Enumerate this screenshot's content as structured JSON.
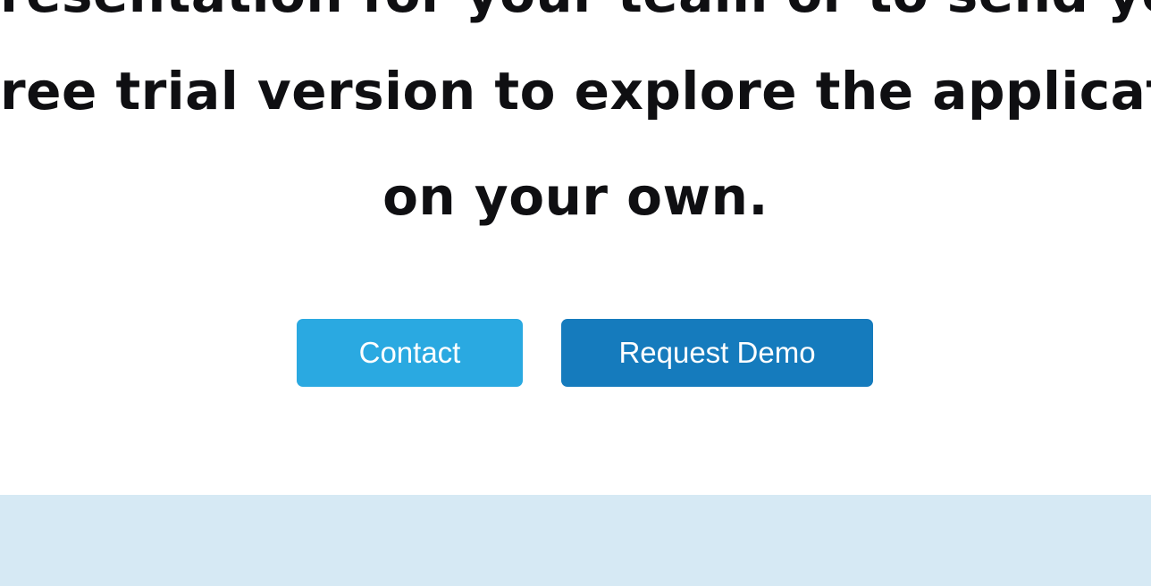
{
  "cta": {
    "lines": [
      "resentation for your team or to send you",
      "ree trial version to explore the application",
      "on your own."
    ]
  },
  "buttons": {
    "contact_label": "Contact",
    "request_demo_label": "Request Demo"
  },
  "colors": {
    "contact_button": "#2aa9e1",
    "request_demo_button": "#157bbd",
    "footer_band": "#d6e9f4",
    "text": "#0f0f12"
  }
}
